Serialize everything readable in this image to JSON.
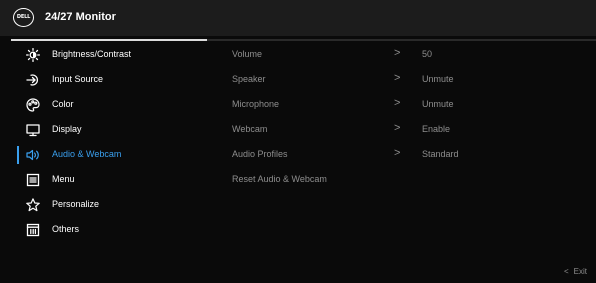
{
  "header": {
    "logo_text": "DELL",
    "title": "24/27 Monitor"
  },
  "menu": {
    "items": [
      {
        "label": "Brightness/Contrast",
        "icon": "brightness-icon"
      },
      {
        "label": "Input Source",
        "icon": "input-source-icon"
      },
      {
        "label": "Color",
        "icon": "color-palette-icon"
      },
      {
        "label": "Display",
        "icon": "display-icon"
      },
      {
        "label": "Audio & Webcam",
        "icon": "speaker-icon",
        "active": true
      },
      {
        "label": "Menu",
        "icon": "menu-icon"
      },
      {
        "label": "Personalize",
        "icon": "star-icon"
      },
      {
        "label": "Others",
        "icon": "others-icon"
      }
    ]
  },
  "submenu": {
    "rows": [
      {
        "label": "Volume",
        "arrow": ">",
        "value": "50"
      },
      {
        "label": "Speaker",
        "arrow": ">",
        "value": "Unmute"
      },
      {
        "label": "Microphone",
        "arrow": ">",
        "value": "Unmute"
      },
      {
        "label": "Webcam",
        "arrow": ">",
        "value": "Enable"
      },
      {
        "label": "Audio Profiles",
        "arrow": ">",
        "value": "Standard"
      },
      {
        "label": "Reset Audio & Webcam"
      }
    ]
  },
  "footer": {
    "exit_arrow": "<",
    "exit_label": "Exit"
  },
  "colors": {
    "accent": "#3aa0ef",
    "header_bg": "#1c1c1c",
    "background": "#0a0a0a",
    "inactive_text": "#8e8e8e"
  }
}
